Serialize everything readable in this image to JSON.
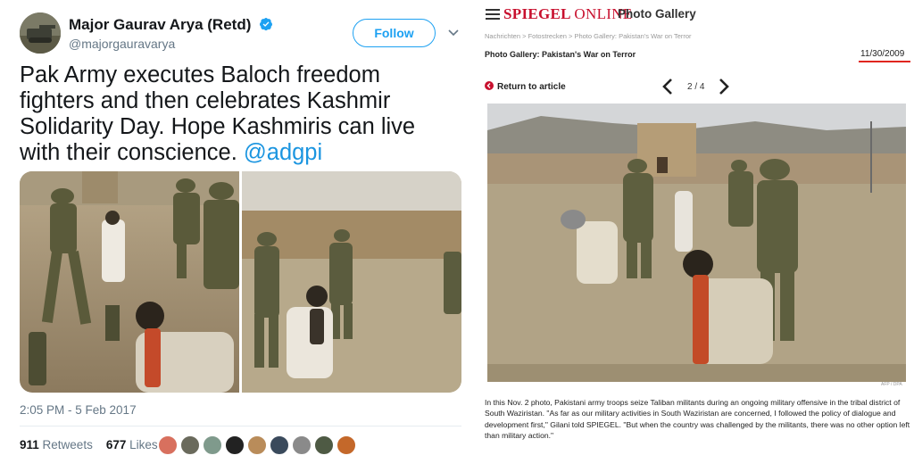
{
  "tweet": {
    "author": {
      "name": "Major Gaurav Arya (Retd)",
      "handle": "@majorgauravarya",
      "verified": true
    },
    "follow_label": "Follow",
    "text": "Pak Army executes Baloch freedom fighters and then celebrates Kashmir Solidarity Day. Hope Kashmiris can live with their conscience. ",
    "mention": "@adgpi",
    "timestamp": "2:05 PM - 5 Feb 2017",
    "retweets_count": "911",
    "retweets_label": "Retweets",
    "likes_count": "677",
    "likes_label": "Likes",
    "colors": {
      "accent": "#1da1f2",
      "muted": "#657786"
    }
  },
  "spiegel": {
    "logo_main": "SPIEGEL",
    "logo_suffix": "ONLINE",
    "section_title": "Photo Gallery",
    "breadcrumb": "Nachrichten > Fotostrecken > Photo Gallery: Pakistan's War on Terror",
    "heading": "Photo Gallery: Pakistan's War on Terror",
    "date": "11/30/2009",
    "return_label": "Return to article",
    "pager": "2 / 4",
    "photo_credit": "AFP / DPA",
    "caption": "In this Nov. 2 photo, Pakistani army troops seize Taliban militants during an ongoing military offensive in the tribal district of South Waziristan. \"As far as our military activities in South Waziristan are concerned, I followed the policy of dialogue and development first,\" Gilani told SPIEGEL. \"But when the country was challenged by the militants, there was no other option left than military action.\"",
    "colors": {
      "brand": "#c8102e",
      "underline": "#e0261f"
    }
  }
}
